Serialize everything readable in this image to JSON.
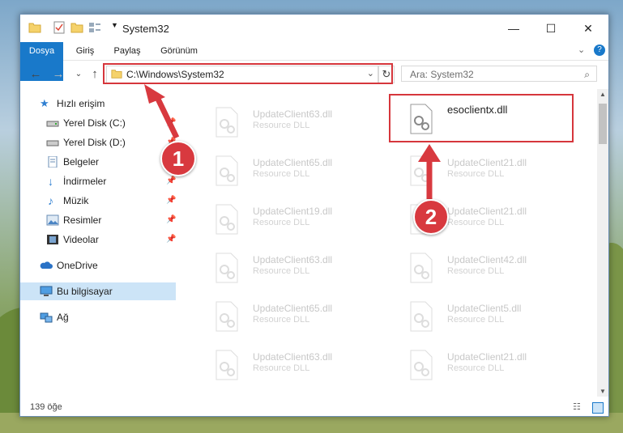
{
  "window": {
    "title": "System32"
  },
  "ribbon": {
    "tabs": [
      "Dosya",
      "Giriş",
      "Paylaş",
      "Görünüm"
    ]
  },
  "address": {
    "path": "C:\\Windows\\System32"
  },
  "search": {
    "placeholder": "Ara: System32"
  },
  "sidebar": {
    "items": [
      {
        "label": "Hızlı erişim",
        "icon": "star-icon"
      },
      {
        "label": "Yerel Disk (C:)",
        "icon": "drive-icon"
      },
      {
        "label": "Yerel Disk (D:)",
        "icon": "drive-icon"
      },
      {
        "label": "Belgeler",
        "icon": "documents-icon"
      },
      {
        "label": "İndirmeler",
        "icon": "download-icon"
      },
      {
        "label": "Müzik",
        "icon": "music-icon"
      },
      {
        "label": "Resimler",
        "icon": "pictures-icon"
      },
      {
        "label": "Videolar",
        "icon": "videos-icon"
      },
      {
        "label": "OneDrive",
        "icon": "cloud-icon"
      },
      {
        "label": "Bu bilgisayar",
        "icon": "computer-icon"
      },
      {
        "label": "Ağ",
        "icon": "network-icon"
      }
    ]
  },
  "files": {
    "left": [
      {
        "name": "UpdateClient63.dll",
        "type": "Resource DLL"
      },
      {
        "name": "UpdateClient65.dll",
        "type": "Resource DLL"
      },
      {
        "name": "UpdateClient19.dll",
        "type": "Resource DLL"
      },
      {
        "name": "UpdateClient63.dll",
        "type": "Resource DLL"
      },
      {
        "name": "UpdateClient65.dll",
        "type": "Resource DLL"
      },
      {
        "name": "UpdateClient63.dll",
        "type": "Resource DLL"
      }
    ],
    "right": [
      {
        "name": "esoclientx.dll",
        "type": ""
      },
      {
        "name": "UpdateClient21.dll",
        "type": "Resource DLL"
      },
      {
        "name": "UpdateClient21.dll",
        "type": "Resource DLL"
      },
      {
        "name": "UpdateClient42.dll",
        "type": "Resource DLL"
      },
      {
        "name": "UpdateClient5.dll",
        "type": "Resource DLL"
      },
      {
        "name": "UpdateClient21.dll",
        "type": "Resource DLL"
      }
    ]
  },
  "status": {
    "count": "139 öğe"
  },
  "annotations": {
    "badge1": "1",
    "badge2": "2"
  },
  "colors": {
    "accent": "#1979ca",
    "highlight": "#d6363c"
  }
}
